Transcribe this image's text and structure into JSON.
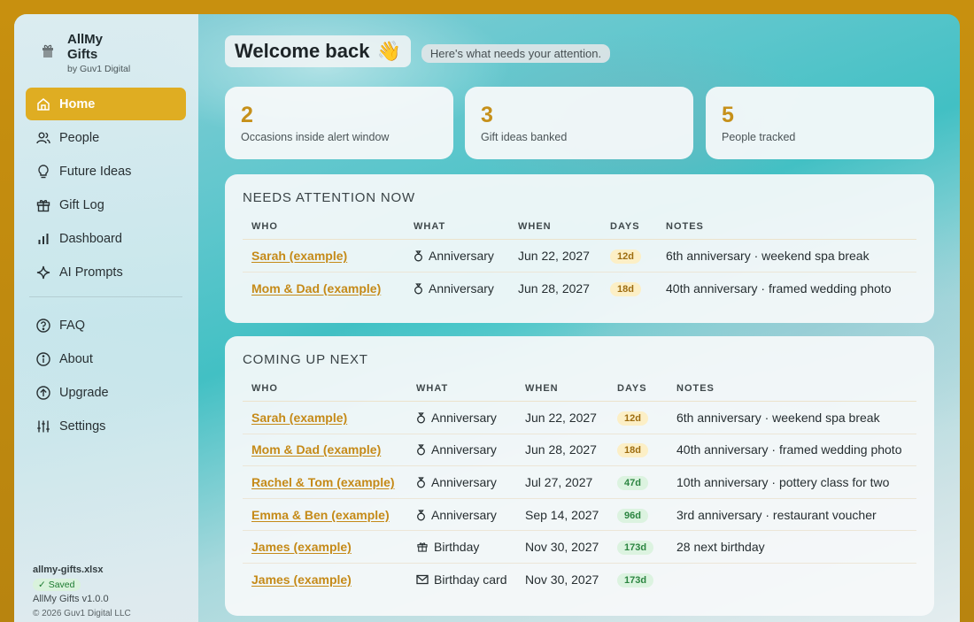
{
  "brand": {
    "name": "AllMy Gifts",
    "byline": "by Guv1 Digital"
  },
  "nav": {
    "primary": [
      {
        "label": "Home",
        "icon": "home-icon",
        "active": true
      },
      {
        "label": "People",
        "icon": "people-icon"
      },
      {
        "label": "Future Ideas",
        "icon": "lightbulb-icon"
      },
      {
        "label": "Gift Log",
        "icon": "gift-icon"
      },
      {
        "label": "Dashboard",
        "icon": "bar-chart-icon"
      },
      {
        "label": "AI Prompts",
        "icon": "sparkle-icon"
      }
    ],
    "secondary": [
      {
        "label": "FAQ",
        "icon": "question-icon"
      },
      {
        "label": "About",
        "icon": "info-icon"
      },
      {
        "label": "Upgrade",
        "icon": "upgrade-arrow-icon"
      },
      {
        "label": "Settings",
        "icon": "sliders-icon"
      }
    ]
  },
  "footer": {
    "file": "allmy-gifts.xlsx",
    "saved": "✓ Saved",
    "version": "AllMy Gifts v1.0.0",
    "copyright": "© 2026 Guv1 Digital LLC"
  },
  "header": {
    "title": "Welcome back",
    "emoji": "👋",
    "subtitle": "Here's what needs your attention."
  },
  "stats": [
    {
      "value": "2",
      "label": "Occasions inside alert window"
    },
    {
      "value": "3",
      "label": "Gift ideas banked"
    },
    {
      "value": "5",
      "label": "People tracked"
    }
  ],
  "columns": [
    "WHO",
    "WHAT",
    "WHEN",
    "DAYS",
    "NOTES"
  ],
  "needs_attention": {
    "title": "NEEDS ATTENTION NOW",
    "rows": [
      {
        "who": "Sarah (example)",
        "what": "Anniversary",
        "icon": "ring-icon",
        "when": "Jun 22, 2027",
        "days": "12d",
        "urgency": "soon",
        "notes": "6th anniversary · weekend spa break"
      },
      {
        "who": "Mom & Dad (example)",
        "what": "Anniversary",
        "icon": "ring-icon",
        "when": "Jun 28, 2027",
        "days": "18d",
        "urgency": "soon",
        "notes": "40th anniversary · framed wedding photo"
      }
    ]
  },
  "coming_up": {
    "title": "COMING UP NEXT",
    "rows": [
      {
        "who": "Sarah (example)",
        "what": "Anniversary",
        "icon": "ring-icon",
        "when": "Jun 22, 2027",
        "days": "12d",
        "urgency": "soon",
        "notes": "6th anniversary · weekend spa break"
      },
      {
        "who": "Mom & Dad (example)",
        "what": "Anniversary",
        "icon": "ring-icon",
        "when": "Jun 28, 2027",
        "days": "18d",
        "urgency": "soon",
        "notes": "40th anniversary · framed wedding photo"
      },
      {
        "who": "Rachel & Tom (example)",
        "what": "Anniversary",
        "icon": "ring-icon",
        "when": "Jul 27, 2027",
        "days": "47d",
        "urgency": "later",
        "notes": "10th anniversary · pottery class for two"
      },
      {
        "who": "Emma & Ben (example)",
        "what": "Anniversary",
        "icon": "ring-icon",
        "when": "Sep 14, 2027",
        "days": "96d",
        "urgency": "later",
        "notes": "3rd anniversary · restaurant voucher"
      },
      {
        "who": "James (example)",
        "what": "Birthday",
        "icon": "gift-icon",
        "when": "Nov 30, 2027",
        "days": "173d",
        "urgency": "later",
        "notes": "28 next birthday"
      },
      {
        "who": "James (example)",
        "what": "Birthday card",
        "icon": "envelope-icon",
        "when": "Nov 30, 2027",
        "days": "173d",
        "urgency": "later",
        "notes": ""
      }
    ]
  }
}
